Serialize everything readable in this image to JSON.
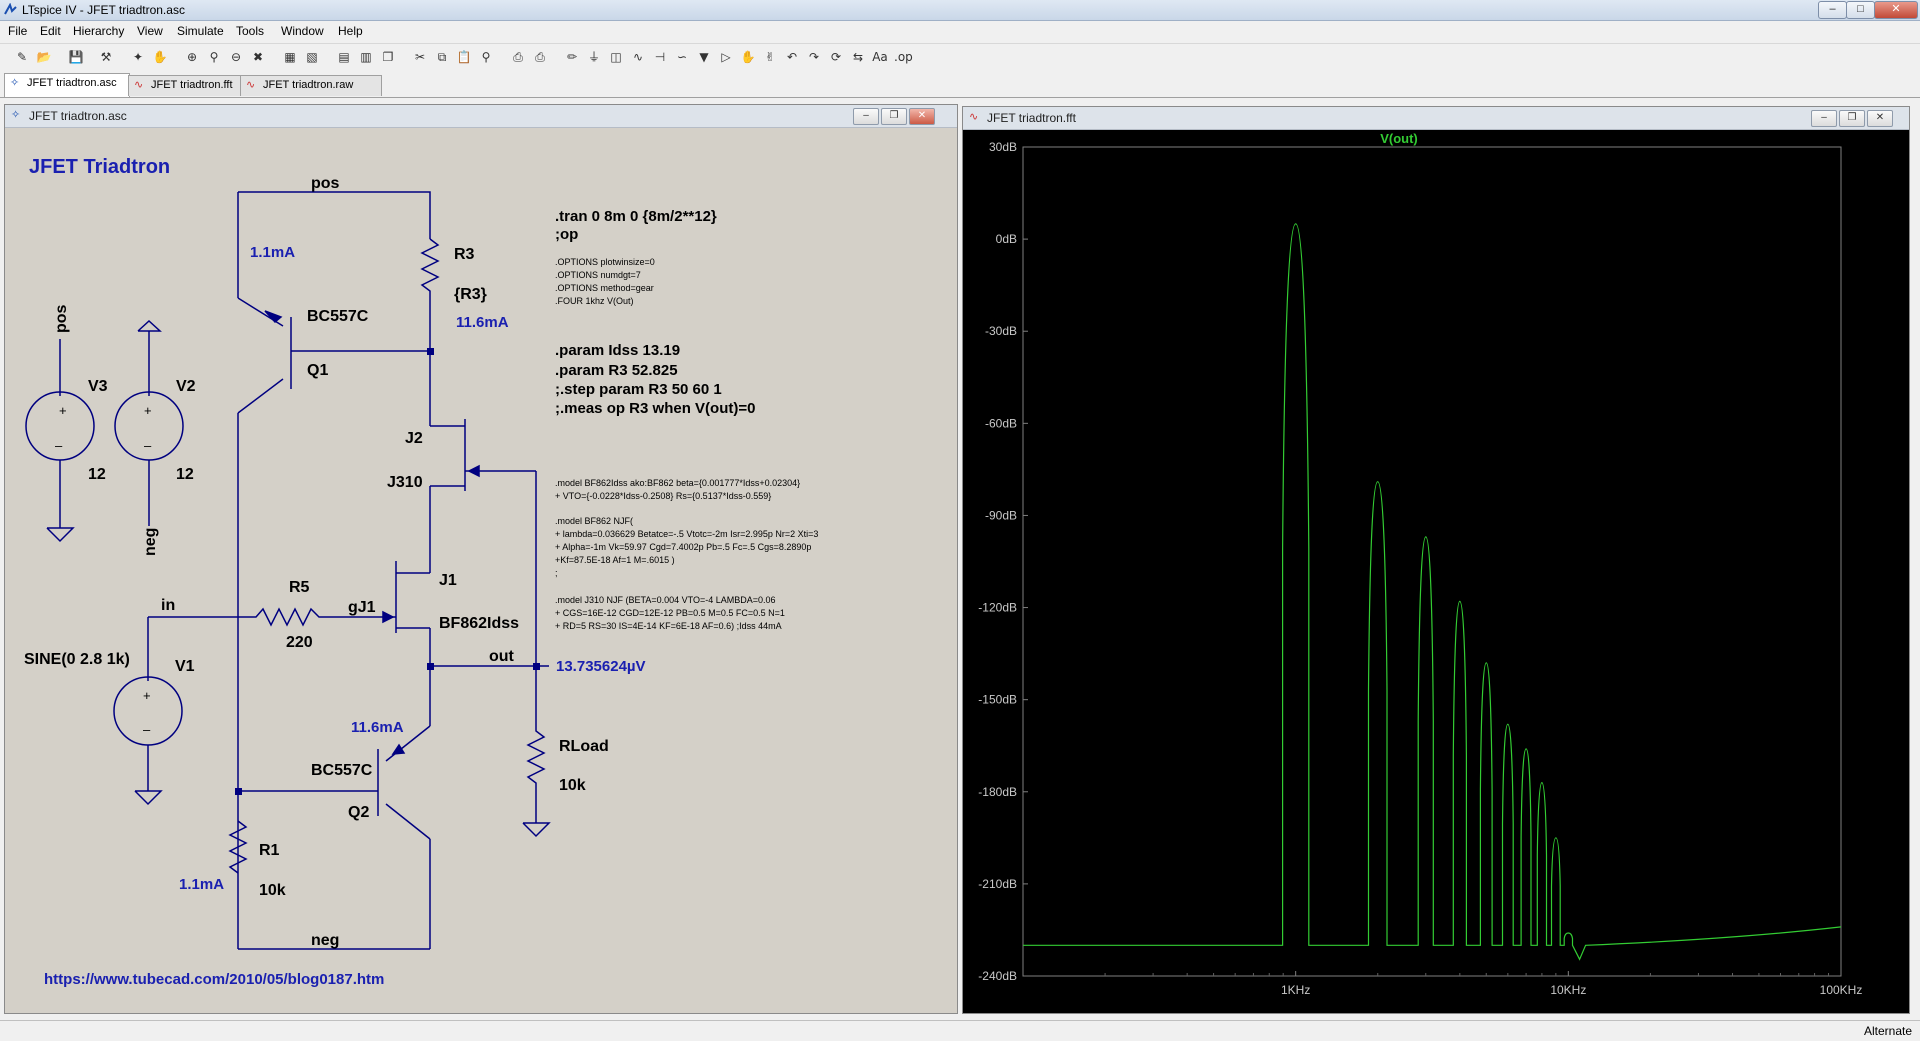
{
  "window": {
    "title": "LTspice IV - JFET triadtron.asc"
  },
  "menu": [
    "File",
    "Edit",
    "Hierarchy",
    "View",
    "Simulate",
    "Tools",
    "Window",
    "Help"
  ],
  "tabs": [
    {
      "label": "JFET triadtron.asc",
      "icon": "schematic-icon"
    },
    {
      "label": "JFET triadtron.fft",
      "icon": "waveform-icon"
    },
    {
      "label": "JFET triadtron.raw",
      "icon": "waveform-icon"
    }
  ],
  "schematic": {
    "window_title": "JFET triadtron.asc",
    "title": "JFET Triadtron",
    "url": "https://www.tubecad.com/2010/05/blog0187.htm",
    "nets": {
      "pos": "pos",
      "neg": "neg",
      "in": "in",
      "out": "out",
      "gJ1": "gJ1"
    },
    "labels": {
      "V3": "V3",
      "V3_val": "12",
      "V2": "V2",
      "V2_val": "12",
      "V1": "V1",
      "V1_val": "SINE(0 2.8 1k)",
      "R3": "R3",
      "R3_val": "{R3}",
      "R5": "R5",
      "R5_val": "220",
      "R1": "R1",
      "R1_val": "10k",
      "RLoad": "RLoad",
      "RLoad_val": "10k",
      "Q1": "Q1",
      "Q1_type": "BC557C",
      "Q2": "Q2",
      "Q2_type": "BC557C",
      "J2": "J2",
      "J2_type": "J310",
      "J1": "J1",
      "J1_type": "BF862Idss"
    },
    "op_values": {
      "q1_current": "1.1mA",
      "r3_current": "11.6mA",
      "q2_current": "11.6mA",
      "r1_current": "1.1mA",
      "out_voltage": "13.735624µV"
    },
    "directives": {
      "tran": ".tran 0 8m 0 {8m/2**12}",
      "op": ";op",
      "options1": ".OPTIONS plotwinsize=0",
      "options2": ".OPTIONS numdgt=7",
      "options3": ".OPTIONS method=gear",
      "four": ".FOUR 1khz V(Out)",
      "param1": ".param Idss 13.19",
      "param2": ".param R3 52.825",
      "step": ";.step param R3 50 60 1",
      "meas": ";.meas op R3 when V(out)=0",
      "model1a": ".model BF862Idss ako:BF862 beta={0.001777*Idss+0.02304}",
      "model1b": "+ VTO={-0.0228*Idss-0.2508} Rs={0.5137*Idss-0.559}",
      "model2a": ".model BF862 NJF(",
      "model2b": "+ lambda=0.036629 Betatce=-.5 Vtotc=-2m Isr=2.995p Nr=2 Xti=3",
      "model2c": "+ Alpha=-1m Vk=59.97 Cgd=7.4002p Pb=.5 Fc=.5 Cgs=8.2890p",
      "model2d": "+Kf=87.5E-18 Af=1 M=.6015 )",
      "model2e": ";",
      "model3a": ".model J310 NJF (BETA=0.004 VTO=-4 LAMBDA=0.06",
      "model3b": "+ CGS=16E-12 CGD=12E-12 PB=0.5 M=0.5 FC=0.5 N=1",
      "model3c": "+ RD=5 RS=30 IS=4E-14 KF=6E-18 AF=0.6) ;Idss 44mA"
    }
  },
  "plot": {
    "window_title": "JFET triadtron.fft",
    "trace_label": "V(out)",
    "trace_color": "#33cc33",
    "y_ticks": [
      "30dB",
      "0dB",
      "-30dB",
      "-60dB",
      "-90dB",
      "-120dB",
      "-150dB",
      "-180dB",
      "-210dB",
      "-240dB"
    ],
    "x_ticks": [
      "1KHz",
      "10KHz",
      "100KHz"
    ]
  },
  "chart_data": {
    "type": "line",
    "title": "",
    "series": [
      {
        "name": "V(out)",
        "harmonics_hz": [
          1000,
          2000,
          3000,
          4000,
          5000,
          6000,
          7000,
          8000,
          9000,
          10000
        ],
        "harmonics_db": [
          5,
          -79,
          -97,
          -118,
          -138,
          -158,
          -166,
          -177,
          -195,
          -226
        ]
      }
    ],
    "noise_floor_db": -230,
    "x_scale": "log",
    "xlim_hz": [
      100,
      100000
    ],
    "ylim_db": [
      -240,
      30
    ],
    "grid": false
  },
  "status": {
    "text": "Alternate"
  }
}
